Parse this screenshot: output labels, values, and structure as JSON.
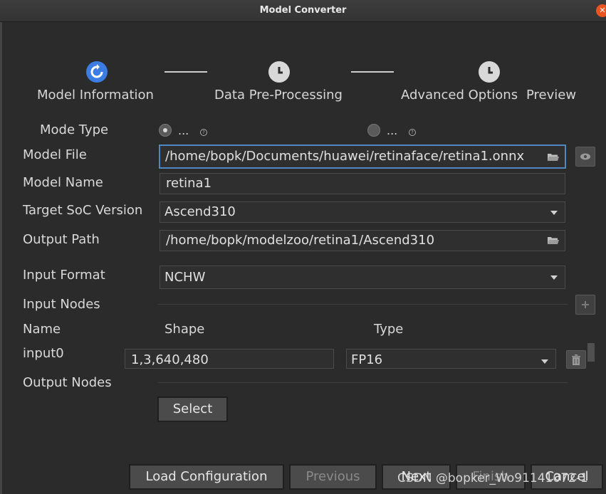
{
  "window": {
    "title": "Model Converter"
  },
  "stepper": {
    "steps": [
      {
        "label": "Model Information",
        "state": "active"
      },
      {
        "label": "Data Pre-Processing",
        "state": "pending"
      },
      {
        "label": "Advanced Options",
        "state": "pending"
      },
      {
        "label": "Preview",
        "state": "pending"
      }
    ]
  },
  "form": {
    "mode_type": {
      "label": "Mode Type",
      "options": [
        {
          "text": "...",
          "checked": true
        },
        {
          "text": "...",
          "checked": false
        }
      ]
    },
    "model_file": {
      "label": "Model File",
      "value": "/home/bopk/Documents/huawei/retinaface/retina1.onnx"
    },
    "model_name": {
      "label": "Model Name",
      "value": "retina1"
    },
    "target_soc": {
      "label": "Target SoC Version",
      "value": "Ascend310"
    },
    "output_path": {
      "label": "Output Path",
      "value": "/home/bopk/modelzoo/retina1/Ascend310"
    },
    "input_format": {
      "label": "Input Format",
      "value": "NCHW"
    },
    "input_nodes": {
      "label": "Input Nodes",
      "columns": {
        "name": "Name",
        "shape": "Shape",
        "type": "Type"
      },
      "rows": [
        {
          "name": "input0",
          "shape": "1,3,640,480",
          "type": "FP16"
        }
      ]
    },
    "output_nodes": {
      "label": "Output Nodes",
      "select_label": "Select"
    }
  },
  "footer": {
    "load_config": "Load Configuration",
    "previous": "Previous",
    "next": "Next",
    "finish": "Finish",
    "cancel": "Cancel"
  },
  "watermark": "CSDN @bopker_Wo91141072-1",
  "colors": {
    "accent": "#3b7de3",
    "focus_border": "#4f87c5",
    "close": "#e95420"
  },
  "icons": {
    "close": "close-icon",
    "folder": "folder-icon",
    "eye": "eye-icon",
    "add": "plus-icon",
    "delete": "trash-icon"
  }
}
